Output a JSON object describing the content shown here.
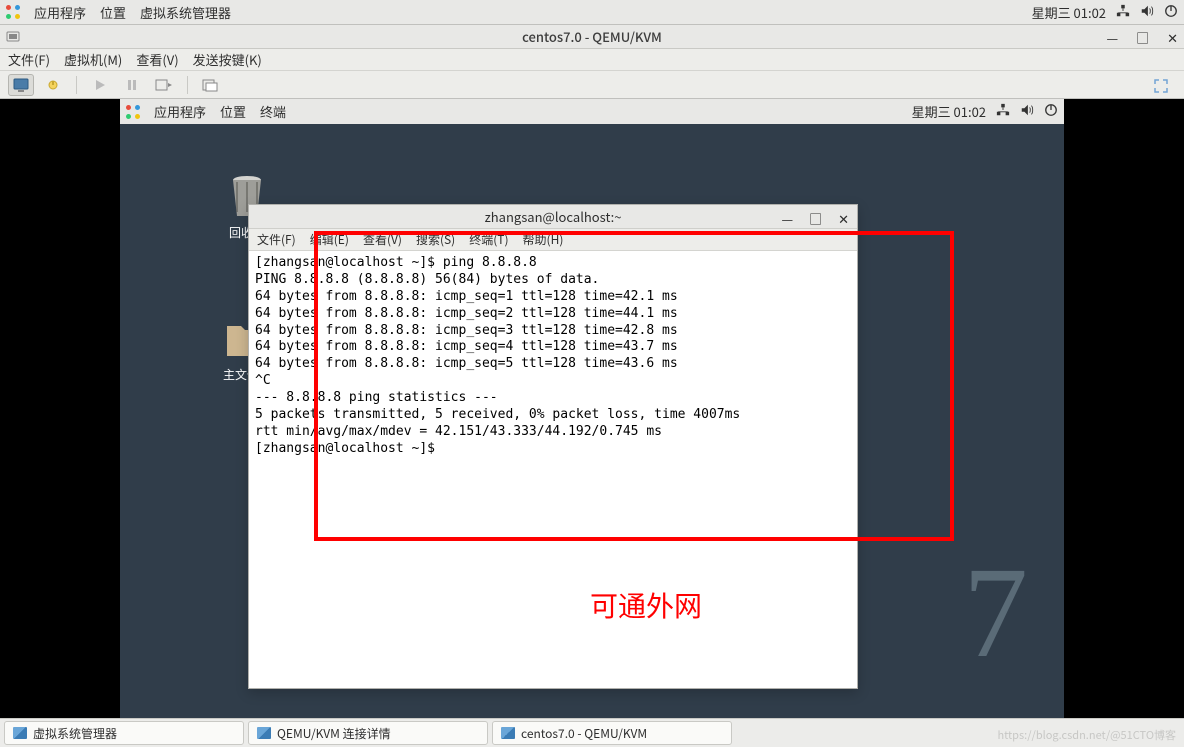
{
  "outer_topbar": {
    "apps": "应用程序",
    "places": "位置",
    "vmm": "虚拟系统管理器",
    "clock": "星期三 01:02"
  },
  "vmm_window": {
    "title": "centos7.0 - QEMU/KVM",
    "menu": {
      "file": "文件(F)",
      "vm": "虚拟机(M)",
      "view": "查看(V)",
      "sendkeys": "发送按键(K)"
    }
  },
  "guest_topbar": {
    "apps": "应用程序",
    "places": "位置",
    "terminal": "终端",
    "clock": "星期三 01:02"
  },
  "desktop": {
    "trash_label": "回收站",
    "home_label": "主文件夹"
  },
  "terminal": {
    "title": "zhangsan@localhost:~",
    "menu": {
      "file": "文件(F)",
      "edit": "编辑(E)",
      "view": "查看(V)",
      "search": "搜索(S)",
      "terminal": "终端(T)",
      "help": "帮助(H)"
    },
    "lines": [
      "[zhangsan@localhost ~]$ ping 8.8.8.8",
      "PING 8.8.8.8 (8.8.8.8) 56(84) bytes of data.",
      "64 bytes from 8.8.8.8: icmp_seq=1 ttl=128 time=42.1 ms",
      "64 bytes from 8.8.8.8: icmp_seq=2 ttl=128 time=44.1 ms",
      "64 bytes from 8.8.8.8: icmp_seq=3 ttl=128 time=42.8 ms",
      "64 bytes from 8.8.8.8: icmp_seq=4 ttl=128 time=43.7 ms",
      "64 bytes from 8.8.8.8: icmp_seq=5 ttl=128 time=43.6 ms",
      "^C",
      "--- 8.8.8.8 ping statistics ---",
      "5 packets transmitted, 5 received, 0% packet loss, time 4007ms",
      "rtt min/avg/max/mdev = 42.151/43.333/44.192/0.745 ms",
      "[zhangsan@localhost ~]$ "
    ]
  },
  "annotation": "可通外网",
  "taskbar": {
    "items": [
      "虚拟系统管理器",
      "QEMU/KVM 连接详情",
      "centos7.0 - QEMU/KVM"
    ]
  },
  "seven": "7",
  "watermark": "https://blog.csdn.net/@51CTO博客"
}
